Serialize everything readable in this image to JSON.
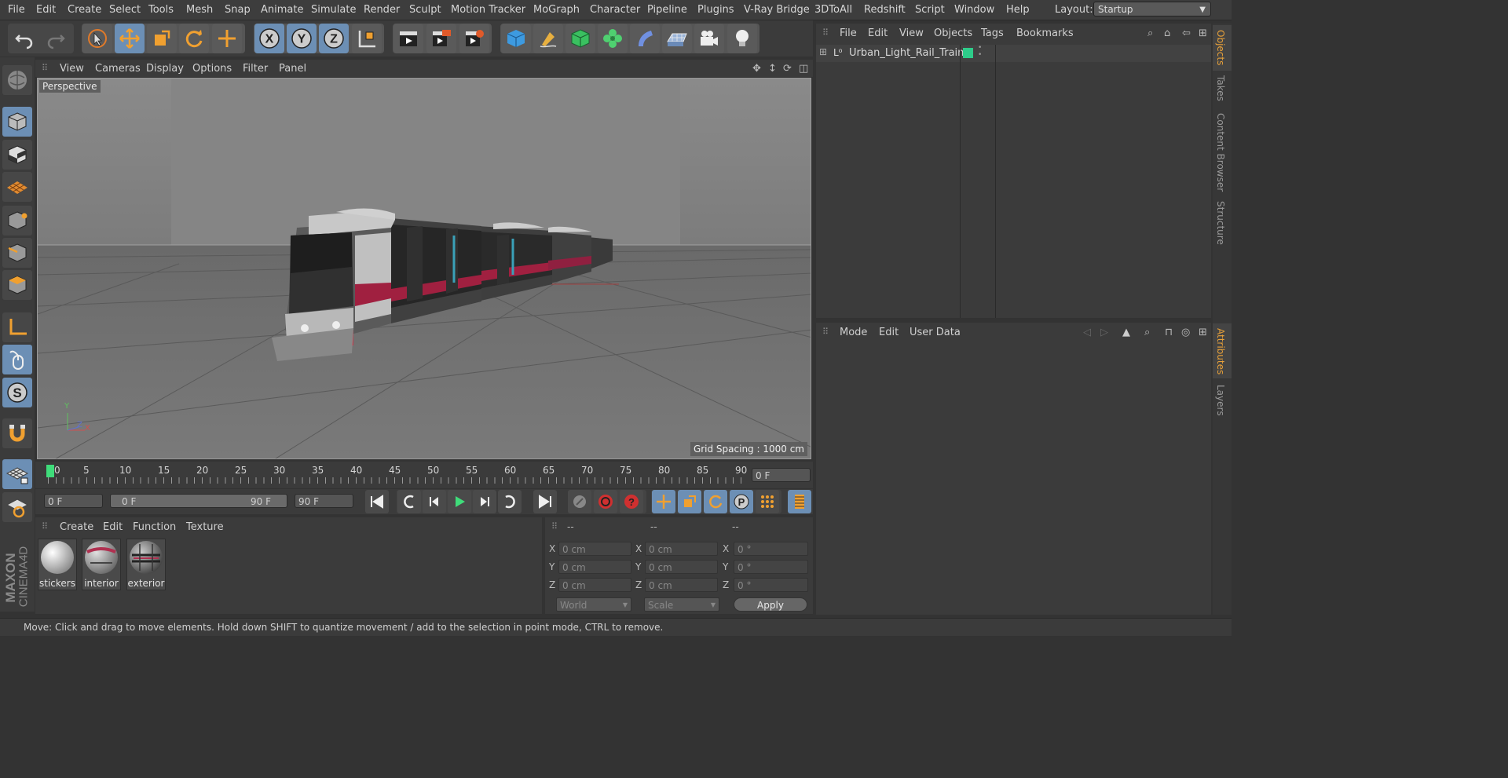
{
  "menubar": {
    "items": [
      "File",
      "Edit",
      "Create",
      "Select",
      "Tools",
      "Mesh",
      "Snap",
      "Animate",
      "Simulate",
      "Render",
      "Sculpt",
      "Motion Tracker",
      "MoGraph",
      "Character",
      "Pipeline",
      "Plugins",
      "V-Ray Bridge",
      "3DToAll",
      "Redshift",
      "Script",
      "Window",
      "Help"
    ],
    "layout_label": "Layout:",
    "layout_value": "Startup"
  },
  "viewport": {
    "menu": [
      "View",
      "Cameras",
      "Display",
      "Options",
      "Filter",
      "Panel"
    ],
    "label": "Perspective",
    "grid_spacing": "Grid Spacing : 1000 cm",
    "axis_y": "Y",
    "axis_z": "Z",
    "axis_x": "X"
  },
  "timeline": {
    "ticks": [
      "0",
      "5",
      "10",
      "15",
      "20",
      "25",
      "30",
      "35",
      "40",
      "45",
      "50",
      "55",
      "60",
      "65",
      "70",
      "75",
      "80",
      "85",
      "90"
    ],
    "current_frame": "0 F",
    "start_field": "0 F",
    "range_start": "0 F",
    "range_end": "90 F",
    "end_field": "90 F"
  },
  "materials": {
    "menu": [
      "Create",
      "Edit",
      "Function",
      "Texture"
    ],
    "items": [
      "stickers",
      "interior",
      "exterior"
    ]
  },
  "coordinates": {
    "headers": [
      "--",
      "--",
      "--"
    ],
    "rows": [
      {
        "axis": "X",
        "pos": "0 cm",
        "size": "0 cm",
        "rot": "0 °"
      },
      {
        "axis": "Y",
        "pos": "0 cm",
        "size": "0 cm",
        "rot": "0 °"
      },
      {
        "axis": "Z",
        "pos": "0 cm",
        "size": "0 cm",
        "rot": "0 °"
      }
    ],
    "mode_world": "World",
    "mode_scale": "Scale",
    "apply_label": "Apply"
  },
  "objects_panel": {
    "menu": [
      "File",
      "Edit",
      "View",
      "Objects",
      "Tags",
      "Bookmarks"
    ],
    "object_name": "Urban_Light_Rail_Train",
    "tag_color": "#2ecc8a"
  },
  "attributes_panel": {
    "menu": [
      "Mode",
      "Edit",
      "User Data"
    ]
  },
  "side_tabs": [
    "Objects",
    "Takes",
    "Content Browser",
    "Structure",
    "Attributes",
    "Layers"
  ],
  "status": "Move: Click and drag to move elements. Hold down SHIFT to quantize movement / add to the selection in point mode, CTRL to remove.",
  "logo": {
    "line1": "MAXON",
    "line2": "CINEMA4D"
  },
  "colors": {
    "accent_blue": "#6c8fb5",
    "accent_orange": "#e8a13a",
    "green": "#2ecc8a"
  }
}
